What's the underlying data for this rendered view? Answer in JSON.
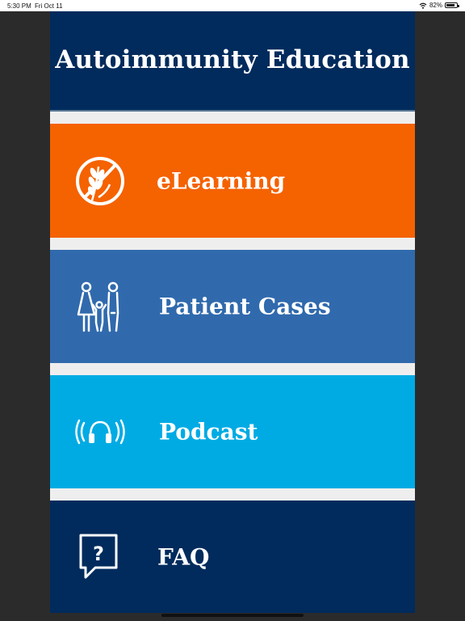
{
  "status_bar": {
    "time": "5:30 PM",
    "date": "Fri Oct 11",
    "battery": "82%",
    "battery_level": 0.82
  },
  "header": {
    "title": "Autoimmunity Education"
  },
  "menu": {
    "elearning": {
      "label": "eLearning",
      "color": "#f56200",
      "icon": "no-gluten-icon"
    },
    "patient_cases": {
      "label": "Patient Cases",
      "color": "#306aad",
      "icon": "family-icon"
    },
    "podcast": {
      "label": "Podcast",
      "color": "#00abe4",
      "icon": "headphones-icon"
    },
    "faq": {
      "label": "FAQ",
      "color": "#002b5c",
      "icon": "question-bubble-icon"
    }
  }
}
